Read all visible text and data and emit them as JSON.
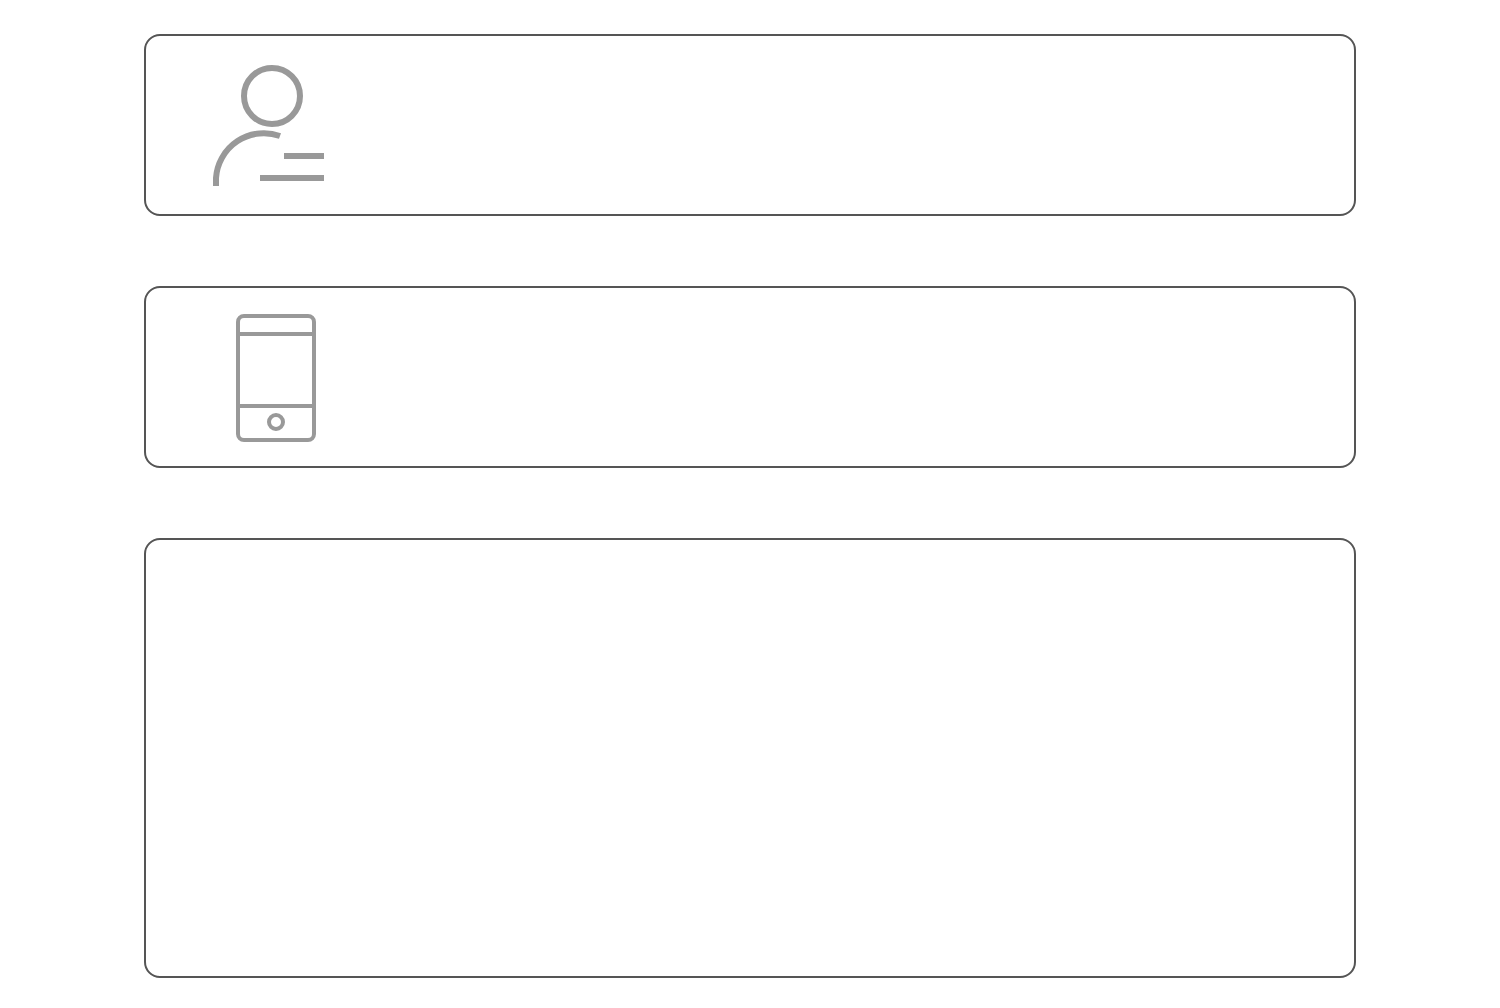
{
  "fields": [
    {
      "kind": "person"
    },
    {
      "kind": "phone"
    },
    {
      "kind": "message"
    }
  ]
}
